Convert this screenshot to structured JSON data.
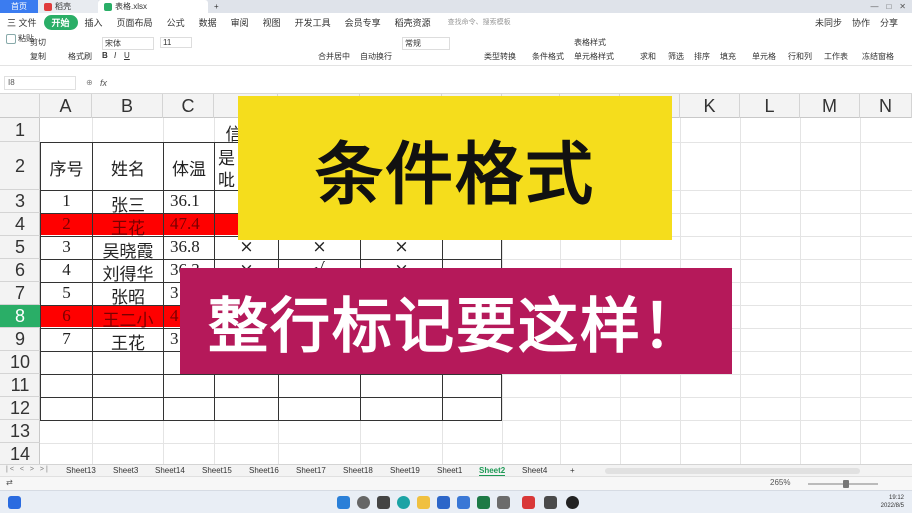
{
  "tabs": {
    "home": "首页",
    "daoke": "稻壳",
    "file": "表格.xlsx"
  },
  "menu": {
    "file": "三 文件",
    "items": [
      "开始",
      "插入",
      "页面布局",
      "公式",
      "数据",
      "审阅",
      "视图",
      "开发工具",
      "会员专享",
      "稻壳资源"
    ],
    "active_index": 0,
    "search_hint": "查找命令、搜索模板",
    "unsync": "未同步",
    "collab": "协作",
    "share": "分享"
  },
  "ribbon": {
    "paste": "粘贴",
    "cut": "剪切",
    "copy": "复制",
    "format_painter": "格式刷",
    "font_name": "宋体",
    "font_size": "11",
    "merge_center": "合并居中",
    "wrap_text": "自动换行",
    "number_format": "常规",
    "type_convert": "类型转换",
    "conditional_format": "条件格式",
    "table_style": "表格样式",
    "cell_style": "单元格样式",
    "sum": "求和",
    "filter": "筛选",
    "sort": "排序",
    "fill": "填充",
    "cells": "单元格",
    "row_col": "行和列",
    "worksheet": "工作表",
    "freeze": "冻结窗格"
  },
  "formula_bar": {
    "name_box": "I8",
    "fx": "fx"
  },
  "columns": [
    "A",
    "B",
    "C",
    "D",
    "E",
    "F",
    "G",
    "H",
    "I",
    "J",
    "K",
    "L",
    "M",
    "N"
  ],
  "rows": [
    "1",
    "2",
    "3",
    "4",
    "5",
    "6",
    "7",
    "8",
    "9",
    "10",
    "11",
    "12",
    "13",
    "14"
  ],
  "selected_row": "8",
  "table": {
    "header_partial": [
      "信",
      "是",
      "吡"
    ],
    "headers": [
      "序号",
      "姓名",
      "体温"
    ],
    "data": [
      [
        "1",
        "张三",
        "36.1"
      ],
      [
        "2",
        "王花",
        "47.4"
      ],
      [
        "3",
        "吴晓霞",
        "36.8"
      ],
      [
        "4",
        "刘得华",
        "36.3"
      ],
      [
        "5",
        "张昭",
        "3"
      ],
      [
        "6",
        "王二小",
        "4"
      ],
      [
        "7",
        "王花",
        "3"
      ]
    ],
    "marks": [
      "×",
      "×",
      "×",
      "×",
      "√",
      "×"
    ]
  },
  "overlay": {
    "title": "条件格式",
    "subtitle": "整行标记要这样！",
    "title_bg": "#f5dd1c",
    "subtitle_bg": "#b5195a"
  },
  "sheets": [
    "Sheet13",
    "Sheet3",
    "Sheet14",
    "Sheet15",
    "Sheet16",
    "Sheet17",
    "Sheet18",
    "Sheet19",
    "Sheet1",
    "Sheet2",
    "Sheet4"
  ],
  "active_sheet": "Sheet2",
  "status": {
    "zoom": "265%"
  },
  "clock": {
    "time": "19:12",
    "date": "2022/8/5"
  },
  "colors": {
    "accent": "#2aae67",
    "highlight_row": "#ff0000"
  }
}
